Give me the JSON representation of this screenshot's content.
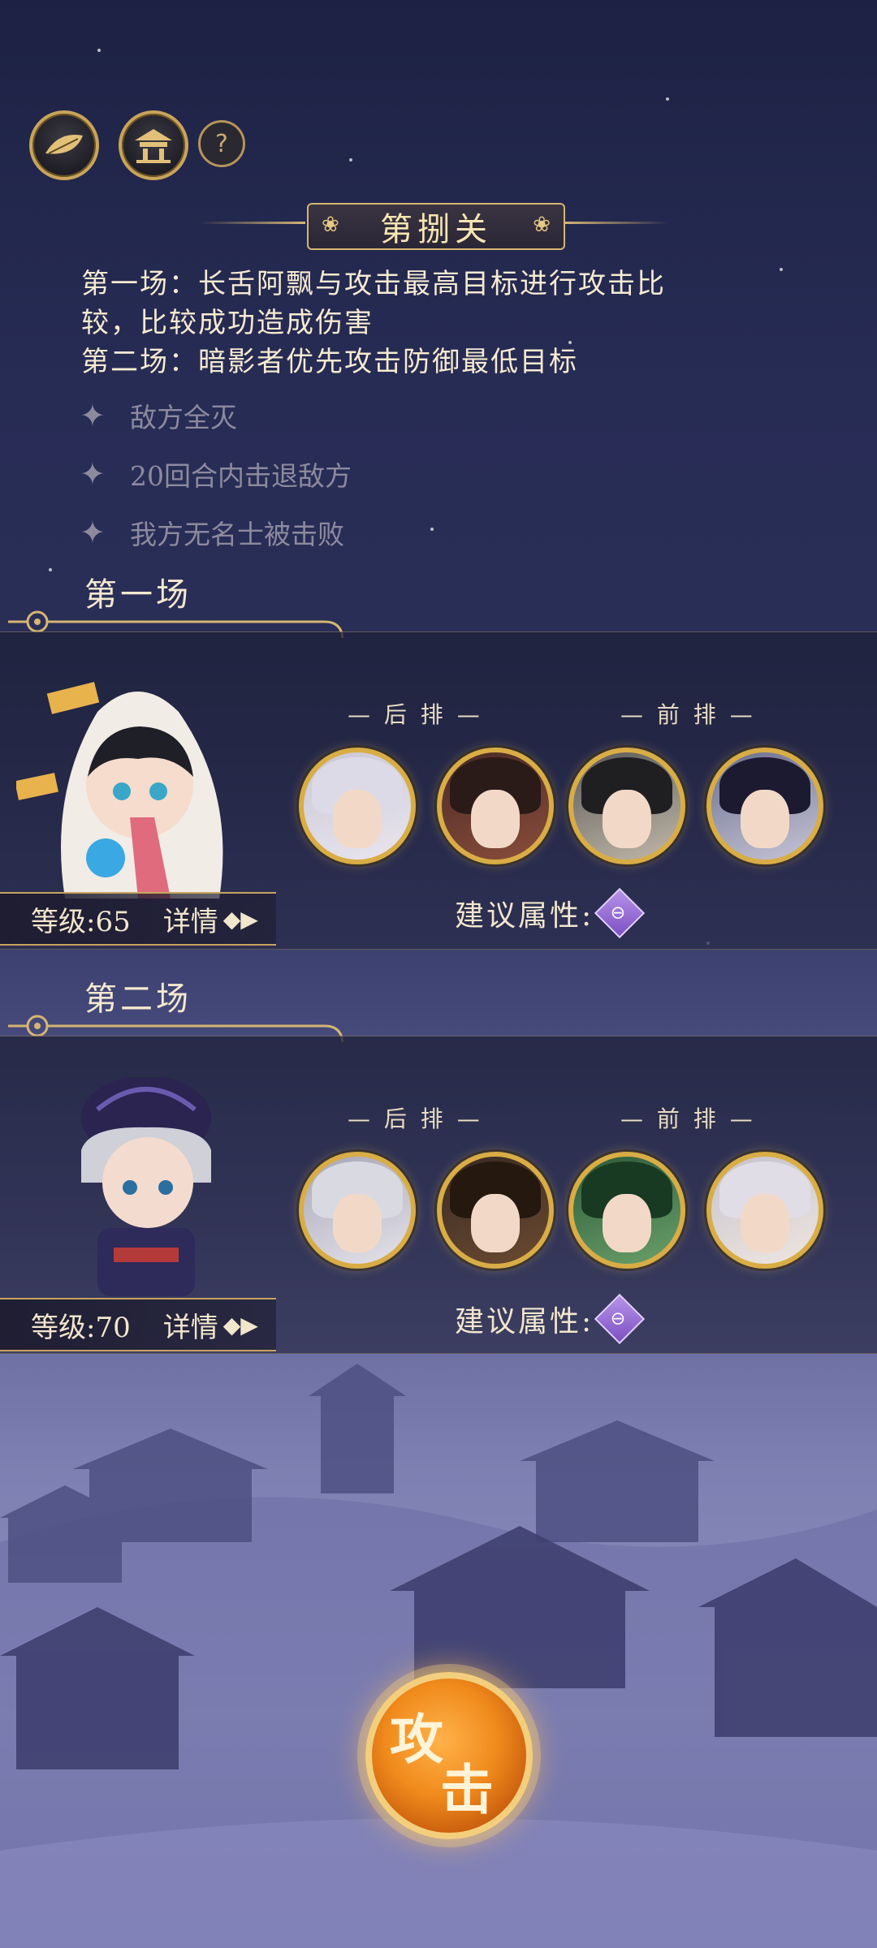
{
  "stage": {
    "title": "第捌关",
    "rules": [
      "第一场：长舌阿飘与攻击最高目标进行攻击比",
      "较，比较成功造成伤害",
      "第二场：暗影者优先攻击防御最低目标"
    ],
    "conditions": [
      "敌方全灭",
      "20回合内击退敌方",
      "我方无名士被击败"
    ]
  },
  "top_icons": [
    "leaf-emblem-icon",
    "pavilion-icon",
    "help-icon"
  ],
  "help_glyph": "?",
  "battles": [
    {
      "label": "第一场",
      "level_text": "等级:65",
      "detail_label": "详情",
      "rear_label": "— 后 排 —",
      "front_label": "— 前 排 —",
      "advice_label": "建议属性:",
      "attr_glyph": "⊖"
    },
    {
      "label": "第二场",
      "level_text": "等级:70",
      "detail_label": "详情",
      "rear_label": "— 后 排 —",
      "front_label": "— 前 排 —",
      "advice_label": "建议属性:",
      "attr_glyph": "⊖"
    }
  ],
  "attack": {
    "char1": "攻",
    "char2": "击"
  },
  "colors": {
    "gold": "#d9ad45",
    "attack_orange": "#f08a1c",
    "attribute_purple": "#9b6fe0"
  }
}
